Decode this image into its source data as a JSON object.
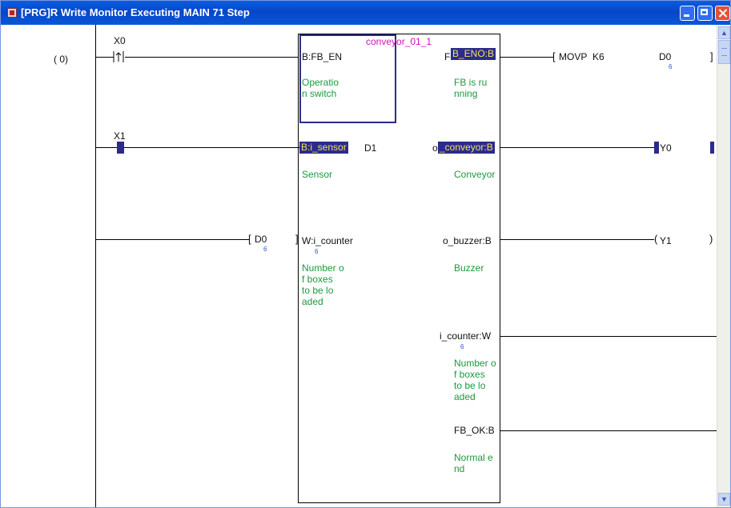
{
  "window": {
    "title": "[PRG]R Write Monitor Executing MAIN 71 Step"
  },
  "ladder": {
    "step": "(   0)",
    "contacts": {
      "x0": "X0",
      "x1": "X1"
    },
    "fb": {
      "instance": "conveyor_01_1",
      "in1_label": "B:FB_EN",
      "in1_comment": [
        "Operatio",
        "n switch"
      ],
      "in2_label": "B:i_sensor",
      "in2_suffix": "D1",
      "in2_comment": "Sensor",
      "in3_label": "W:i_counter",
      "in3_value": "6",
      "in3_comment": [
        "Number o",
        "f boxes",
        "to be lo",
        "aded"
      ],
      "out1_label": "B_ENO:B",
      "out1_prefix": "F",
      "out1_comment": [
        "FB is ru",
        "nning"
      ],
      "out2_label": "_conveyor:B",
      "out2_prefix": "o",
      "out2_comment": "Conveyor",
      "out3_label": "o_buzzer:B",
      "out3_comment": "Buzzer",
      "out4_label": "i_counter:W",
      "out4_value": "6",
      "out4_comment": [
        "Number o",
        "f boxes",
        "to be lo",
        "aded"
      ],
      "out5_label": "FB_OK:B",
      "out5_comment": [
        "Normal e",
        "nd"
      ]
    },
    "movp": {
      "instr": "MOVP",
      "src": "K6",
      "dst": "D0",
      "dst_value": "6"
    },
    "d0_contact": {
      "label": "D0",
      "value": "6"
    },
    "coils": {
      "y0": "Y0",
      "y1": "Y1"
    }
  },
  "colors": {
    "titlebar": "#0a56d8",
    "highlight": "#2b2b8c",
    "comment_green": "#1b9a3d",
    "instance_magenta": "#d10fc0"
  }
}
